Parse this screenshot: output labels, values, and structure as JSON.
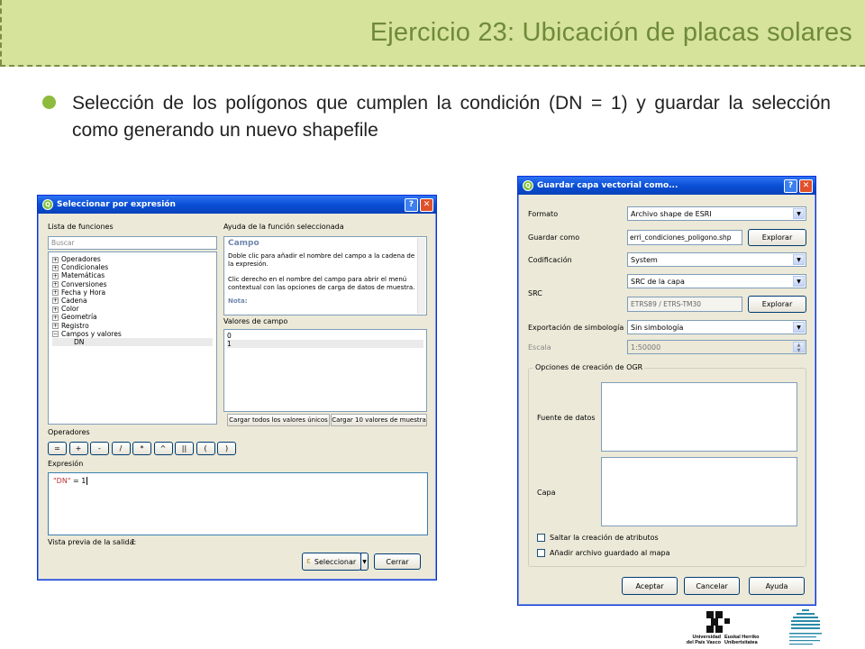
{
  "slide": {
    "title": "Ejercicio 23: Ubicación de placas solares",
    "bullet": "Selección de los polígonos que cumplen la condición (DN = 1) y guardar la selección como generando un nuevo shapefile"
  },
  "select_dialog": {
    "title": "Seleccionar por expresión",
    "function_list_label": "Lista de funciones",
    "search_placeholder": "Buscar",
    "tree": [
      "Operadores",
      "Condicionales",
      "Matemáticas",
      "Conversiones",
      "Fecha y Hora",
      "Cadena",
      "Color",
      "Geometría",
      "Registro",
      "Campos y valores"
    ],
    "tree_child": "DN",
    "help_label": "Ayuda de la función seleccionada",
    "help_heading": "Campo",
    "help_p1": "Doble clic para añadir el nombre del campo a la cadena de la expresión.",
    "help_p2": "Clic derecho en el nombre del campo para abrir el menú contextual con las opciones de carga de datos de muestra.",
    "help_note": "Nota:",
    "values_label": "Valores de campo",
    "values": [
      "0",
      "1"
    ],
    "load_all_btn": "Cargar todos los valores únicos",
    "load_sample_btn": "Cargar 10 valores de muestra",
    "operators_label": "Operadores",
    "operators": [
      "=",
      "+",
      "-",
      "/",
      "*",
      "^",
      "||",
      "(",
      ")"
    ],
    "expression_label": "Expresión",
    "expression_field": "\"DN\"",
    "expression_rest": " = 1",
    "preview_label": "Vista previa de la salida:",
    "preview_value": "1",
    "select_btn": "Seleccionar",
    "close_btn": "Cerrar"
  },
  "save_dialog": {
    "title": "Guardar capa vectorial como...",
    "format_label": "Formato",
    "format_value": "Archivo shape de ESRI",
    "save_as_label": "Guardar como",
    "save_as_value": "erri_condiciones_poligono.shp",
    "browse_btn": "Explorar",
    "encoding_label": "Codificación",
    "encoding_value": "System",
    "src_label": "SRC",
    "src_value": "SRC de la capa",
    "crs_value": "ETRS89 / ETRS-TM30",
    "browse_btn2": "Explorar",
    "symbology_label": "Exportación de simbología",
    "symbology_value": "Sin simbología",
    "scale_label": "Escala",
    "scale_value": "1:50000",
    "ogr_group": "Opciones de creación de OGR",
    "datasource_label": "Fuente de datos",
    "layer_label": "Capa",
    "skip_attr": "Saltar la creación de atributos",
    "add_to_map": "Añadir archivo guardado al mapa",
    "accept_btn": "Aceptar",
    "cancel_btn": "Cancelar",
    "help_btn": "Ayuda"
  },
  "logos": {
    "upv_line1": "Universidad",
    "upv_line2": "del País Vasco",
    "ehu_line1": "Euskal Herriko",
    "ehu_line2": "Unibertsitatea"
  },
  "colors": {
    "header_bg": "#d6e39b",
    "title_color": "#6f8a38",
    "bullet_color": "#8dbb3b",
    "titlebar_blue": "#0a4fd6"
  }
}
